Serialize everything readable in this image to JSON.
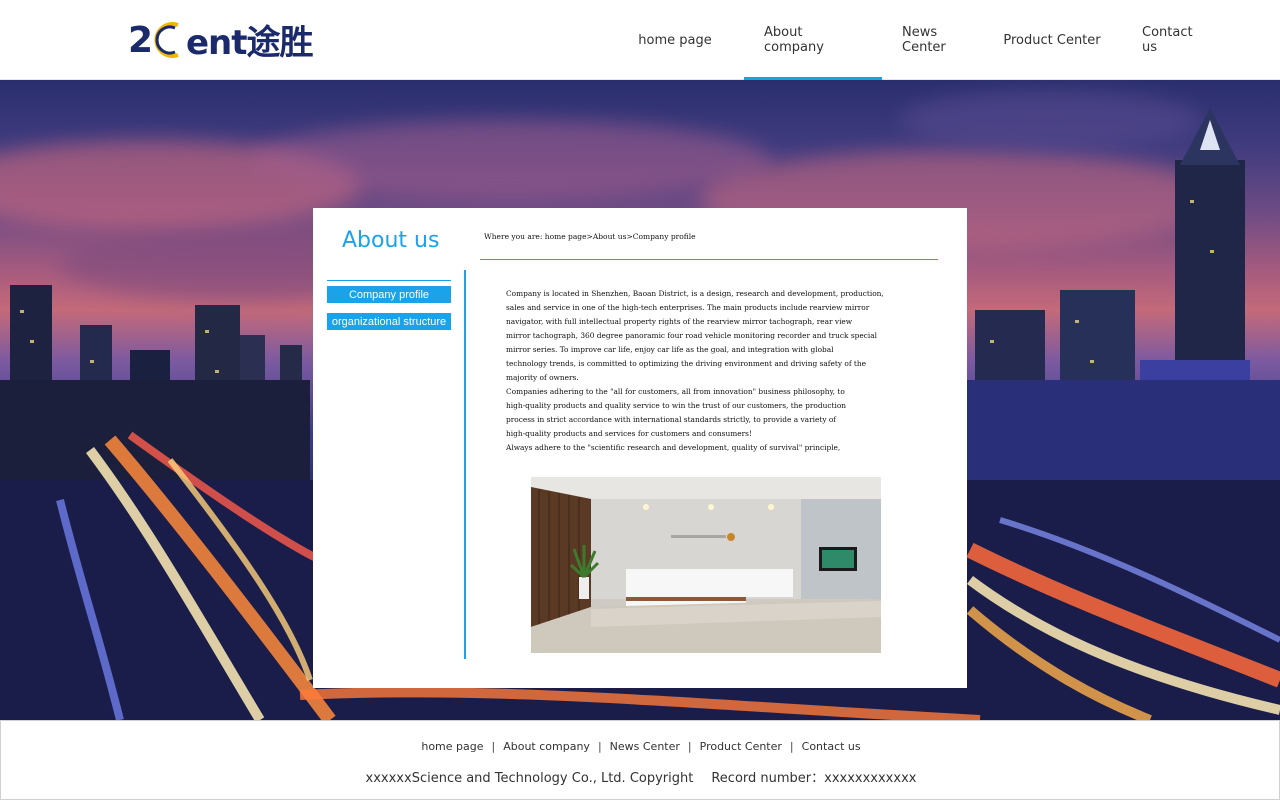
{
  "brand": {
    "logo_text": "ent途胜",
    "colors": {
      "navy": "#1b2a6b",
      "accent": "#1aa3e8",
      "gold": "#f2b600"
    }
  },
  "nav": {
    "items": [
      {
        "label": "home page"
      },
      {
        "label": "About company"
      },
      {
        "label": "News Center"
      },
      {
        "label": "Product Center"
      },
      {
        "label": "Contact us"
      }
    ],
    "active": "About company"
  },
  "card": {
    "title": "About us",
    "breadcrumb": "Where you are: home page>About us>Company profile",
    "side_menu": [
      {
        "label": "Company profile"
      },
      {
        "label": "organizational structure"
      }
    ],
    "paragraph_lines": [
      "Company is located in Shenzhen, Baoan District, is a design, research and development, production,",
      "sales and service in one of the high-tech enterprises. The main products include rearview mirror",
      "navigator, with full intellectual property rights of the rearview mirror tachograph, rear view",
      "mirror tachograph, 360 degree panoramic four road vehicle monitoring recorder and truck special",
      "mirror series. To improve car life, enjoy car life as the goal, and integration with global",
      "technology trends, is committed to optimizing the driving environment and driving safety of the",
      "majority of owners.",
      "Companies adhering to the \"all for customers, all from innovation\" business philosophy, to",
      "high-quality products and quality service to win the trust of our customers, the production",
      "process in strict accordance with international standards strictly, to provide a variety of",
      "high-quality products and services for customers and consumers!",
      "Always adhere to the \"scientific research and development, quality of survival\" principle,"
    ]
  },
  "footer": {
    "links": [
      {
        "label": "home page"
      },
      {
        "label": "About company"
      },
      {
        "label": "News Center"
      },
      {
        "label": "Product Center"
      },
      {
        "label": "Contact us"
      }
    ],
    "copyright": "xxxxxxScience and Technology Co., Ltd.  Copyright",
    "record": "Record number：xxxxxxxxxxxx"
  }
}
